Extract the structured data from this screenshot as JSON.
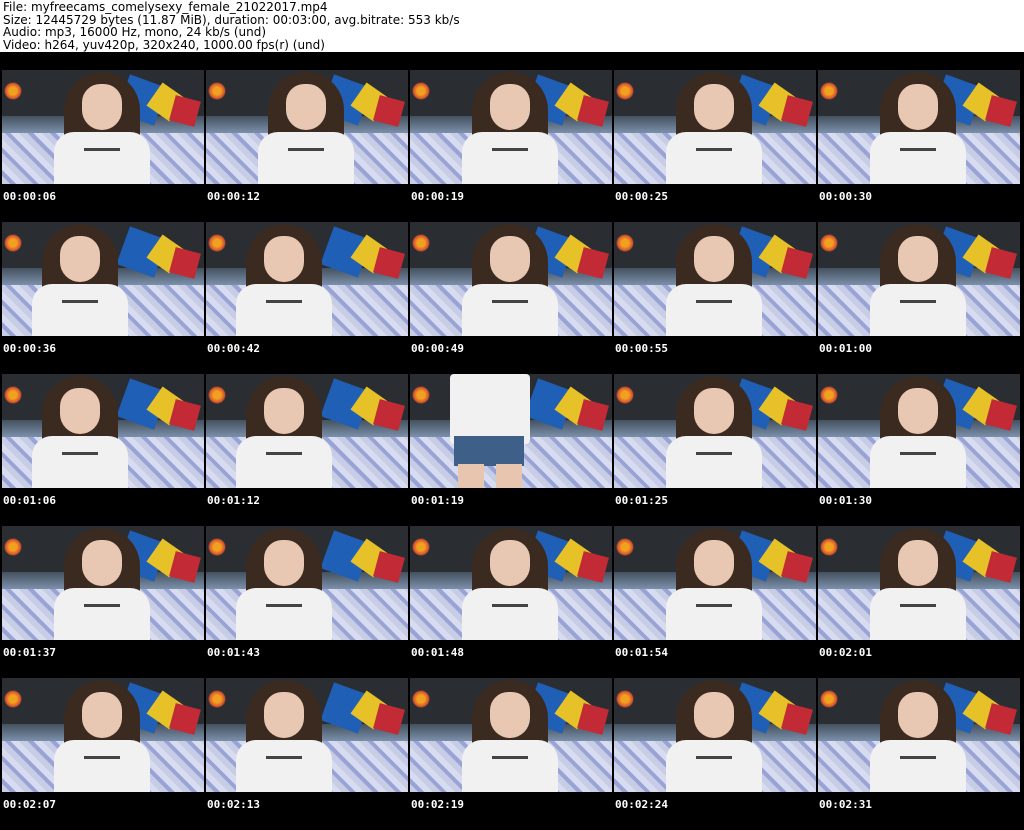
{
  "header": {
    "file_line": "File: myfreecams_comelysexy_female_21022017.mp4",
    "size_line": "Size: 12445729 bytes (11.87 MiB), duration: 00:03:00, avg.bitrate: 553 kb/s",
    "audio_line": "Audio: mp3, 16000 Hz, mono, 24 kb/s (und)",
    "video_line": "Video: h264, yuv420p, 320x240, 1000.00 fps(r) (und)"
  },
  "thumbnails": [
    {
      "timestamp": "00:00:06"
    },
    {
      "timestamp": "00:00:12"
    },
    {
      "timestamp": "00:00:19"
    },
    {
      "timestamp": "00:00:25"
    },
    {
      "timestamp": "00:00:30"
    },
    {
      "timestamp": "00:00:36"
    },
    {
      "timestamp": "00:00:42"
    },
    {
      "timestamp": "00:00:49"
    },
    {
      "timestamp": "00:00:55"
    },
    {
      "timestamp": "00:01:00"
    },
    {
      "timestamp": "00:01:06"
    },
    {
      "timestamp": "00:01:12"
    },
    {
      "timestamp": "00:01:19"
    },
    {
      "timestamp": "00:01:25"
    },
    {
      "timestamp": "00:01:30"
    },
    {
      "timestamp": "00:01:37"
    },
    {
      "timestamp": "00:01:43"
    },
    {
      "timestamp": "00:01:48"
    },
    {
      "timestamp": "00:01:54"
    },
    {
      "timestamp": "00:02:01"
    },
    {
      "timestamp": "00:02:07"
    },
    {
      "timestamp": "00:02:13"
    },
    {
      "timestamp": "00:02:19"
    },
    {
      "timestamp": "00:02:24"
    },
    {
      "timestamp": "00:02:31"
    }
  ]
}
